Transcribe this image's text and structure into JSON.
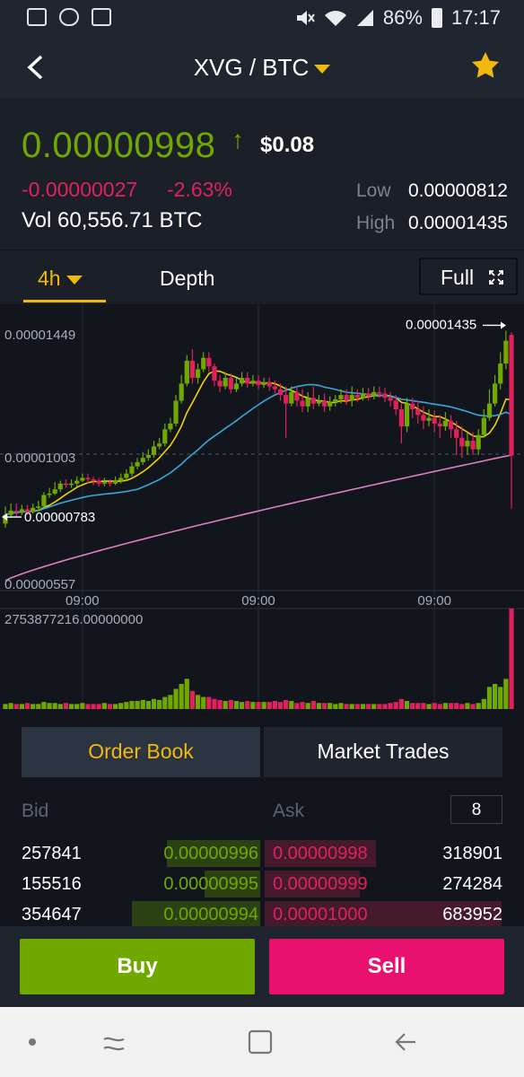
{
  "status_bar": {
    "battery": "86%",
    "time": "17:17",
    "icons": [
      "image-icon",
      "incognito-icon",
      "notification-icon",
      "mute-icon",
      "wifi-icon",
      "signal-icon",
      "battery-icon"
    ]
  },
  "header": {
    "pair": "XVG / BTC",
    "back_icon": "chevron-left-icon",
    "favorite_icon": "star-icon",
    "accent_color": "#f0b90b"
  },
  "ticker": {
    "last_price": "0.00000998",
    "direction_arrow": "↑",
    "usd_price": "$0.08",
    "change_abs": "-0.00000027",
    "change_pct": "-2.63%",
    "volume": "Vol 60,556.71 BTC",
    "low_label": "Low",
    "low_value": "0.00000812",
    "high_label": "High",
    "high_value": "0.00001435",
    "up_color": "#70a800",
    "down_color": "#e0215d"
  },
  "chart_tabs": {
    "interval": "4h",
    "depth": "Depth",
    "full": "Full"
  },
  "chart_data": {
    "type": "candlestick",
    "interval": "4h",
    "y_axis_labels": [
      "0.00001449",
      "0.00001003",
      "0.00000557"
    ],
    "ylim": [
      5.57e-06,
      1.449e-05
    ],
    "x_tick_labels": [
      "09:00",
      "09:00",
      "09:00"
    ],
    "x_tick_indices": [
      14,
      46,
      78
    ],
    "high_marker": "0.00001435",
    "low_marker": "0.00000783",
    "volume_axis_label": "2753877216.00000000",
    "dashed_reference_price": 1.003e-05,
    "candles": [
      [
        7.6e-06,
        7.9e-06,
        8.2e-06,
        7.45e-06
      ],
      [
        7.9e-06,
        8.05e-06,
        8.3e-06,
        7.8e-06
      ],
      [
        8.05e-06,
        8e-06,
        8.3e-06,
        7.83e-06
      ],
      [
        8e-06,
        8.1e-06,
        8.25e-06,
        7.9e-06
      ],
      [
        8.1e-06,
        8e-06,
        8.25e-06,
        7.9e-06
      ],
      [
        8e-06,
        8.15e-06,
        8.3e-06,
        7.95e-06
      ],
      [
        8.15e-06,
        8.2e-06,
        8.4e-06,
        8.05e-06
      ],
      [
        8.2e-06,
        8.6e-06,
        8.7e-06,
        8.15e-06
      ],
      [
        8.6e-06,
        8.65e-06,
        8.85e-06,
        8.5e-06
      ],
      [
        8.65e-06,
        8.8e-06,
        9.05e-06,
        8.6e-06
      ],
      [
        8.8e-06,
        9e-06,
        9.1e-06,
        8.7e-06
      ],
      [
        9e-06,
        8.95e-06,
        9.15e-06,
        8.85e-06
      ],
      [
        8.95e-06,
        9e-06,
        9.15e-06,
        8.85e-06
      ],
      [
        9e-06,
        9.1e-06,
        9.25e-06,
        8.9e-06
      ],
      [
        9.1e-06,
        9.2e-06,
        9.35e-06,
        9.05e-06
      ],
      [
        9.2e-06,
        9.15e-06,
        9.35e-06,
        9e-06
      ],
      [
        9.15e-06,
        9.1e-06,
        9.25e-06,
        8.95e-06
      ],
      [
        9.1e-06,
        9e-06,
        9.2e-06,
        8.9e-06
      ],
      [
        9e-06,
        9.05e-06,
        9.2e-06,
        8.9e-06
      ],
      [
        9.05e-06,
        9e-06,
        9.15e-06,
        8.9e-06
      ],
      [
        9e-06,
        9.1e-06,
        9.25e-06,
        8.95e-06
      ],
      [
        9.1e-06,
        9.2e-06,
        9.35e-06,
        9e-06
      ],
      [
        9.2e-06,
        9.35e-06,
        9.5e-06,
        9.1e-06
      ],
      [
        9.35e-06,
        9.6e-06,
        9.75e-06,
        9.25e-06
      ],
      [
        9.6e-06,
        9.75e-06,
        9.9e-06,
        9.5e-06
      ],
      [
        9.75e-06,
        9.9e-06,
        1.01e-05,
        9.65e-06
      ],
      [
        9.9e-06,
        1e-05,
        1.02e-05,
        9.8e-06
      ],
      [
        1e-05,
        1.03e-05,
        1.05e-05,
        9.9e-06
      ],
      [
        1.03e-05,
        1.04e-05,
        1.06e-05,
        1.02e-05
      ],
      [
        1.04e-05,
        1.09e-05,
        1.11e-05,
        1.03e-05
      ],
      [
        1.09e-05,
        1.11e-05,
        1.13e-05,
        1.08e-05
      ],
      [
        1.11e-05,
        1.19e-05,
        1.21e-05,
        1.1e-05
      ],
      [
        1.19e-05,
        1.25e-05,
        1.28e-05,
        1.18e-05
      ],
      [
        1.25e-05,
        1.33e-05,
        1.35e-05,
        1.24e-05
      ],
      [
        1.33e-05,
        1.27e-05,
        1.37e-05,
        1.25e-05
      ],
      [
        1.27e-05,
        1.3e-05,
        1.32e-05,
        1.25e-05
      ],
      [
        1.3e-05,
        1.34e-05,
        1.36e-05,
        1.29e-05
      ],
      [
        1.34e-05,
        1.31e-05,
        1.36e-05,
        1.29e-05
      ],
      [
        1.31e-05,
        1.26e-05,
        1.32e-05,
        1.24e-05
      ],
      [
        1.26e-05,
        1.24e-05,
        1.28e-05,
        1.22e-05
      ],
      [
        1.24e-05,
        1.27e-05,
        1.29e-05,
        1.23e-05
      ],
      [
        1.27e-05,
        1.23e-05,
        1.285e-05,
        1.215e-05
      ],
      [
        1.23e-05,
        1.25e-05,
        1.27e-05,
        1.22e-05
      ],
      [
        1.25e-05,
        1.27e-05,
        1.29e-05,
        1.24e-05
      ],
      [
        1.27e-05,
        1.25e-05,
        1.29e-05,
        1.235e-05
      ],
      [
        1.25e-05,
        1.26e-05,
        1.28e-05,
        1.24e-05
      ],
      [
        1.26e-05,
        1.245e-05,
        1.28e-05,
        1.23e-05
      ],
      [
        1.245e-05,
        1.255e-05,
        1.27e-05,
        1.235e-05
      ],
      [
        1.255e-05,
        1.24e-05,
        1.27e-05,
        1.225e-05
      ],
      [
        1.24e-05,
        1.23e-05,
        1.26e-05,
        1.215e-05
      ],
      [
        1.23e-05,
        1.21e-05,
        1.25e-05,
        1.19e-05
      ],
      [
        1.21e-05,
        1.18e-05,
        1.24e-05,
        1.06e-05
      ],
      [
        1.18e-05,
        1.22e-05,
        1.24e-05,
        1.17e-05
      ],
      [
        1.22e-05,
        1.19e-05,
        1.24e-05,
        1.17e-05
      ],
      [
        1.19e-05,
        1.17e-05,
        1.23e-05,
        1.15e-05
      ],
      [
        1.17e-05,
        1.2e-05,
        1.22e-05,
        1.15e-05
      ],
      [
        1.2e-05,
        1.18e-05,
        1.24e-05,
        1.16e-05
      ],
      [
        1.18e-05,
        1.19e-05,
        1.21e-05,
        1.17e-05
      ],
      [
        1.19e-05,
        1.17e-05,
        1.215e-05,
        1.15e-05
      ],
      [
        1.17e-05,
        1.185e-05,
        1.205e-05,
        1.155e-05
      ],
      [
        1.185e-05,
        1.195e-05,
        1.21e-05,
        1.17e-05
      ],
      [
        1.195e-05,
        1.21e-05,
        1.23e-05,
        1.18e-05
      ],
      [
        1.21e-05,
        1.19e-05,
        1.23e-05,
        1.175e-05
      ],
      [
        1.19e-05,
        1.21e-05,
        1.24e-05,
        1.17e-05
      ],
      [
        1.21e-05,
        1.2e-05,
        1.23e-05,
        1.185e-05
      ],
      [
        1.2e-05,
        1.215e-05,
        1.235e-05,
        1.19e-05
      ],
      [
        1.215e-05,
        1.205e-05,
        1.235e-05,
        1.19e-05
      ],
      [
        1.205e-05,
        1.22e-05,
        1.24e-05,
        1.195e-05
      ],
      [
        1.22e-05,
        1.215e-05,
        1.24e-05,
        1.2e-05
      ],
      [
        1.215e-05,
        1.2e-05,
        1.235e-05,
        1.185e-05
      ],
      [
        1.2e-05,
        1.19e-05,
        1.22e-05,
        1.17e-05
      ],
      [
        1.19e-05,
        1.16e-05,
        1.21e-05,
        1.14e-05
      ],
      [
        1.16e-05,
        1.1e-05,
        1.18e-05,
        1.04e-05
      ],
      [
        1.1e-05,
        1.18e-05,
        1.2e-05,
        1.08e-05
      ],
      [
        1.18e-05,
        1.16e-05,
        1.2e-05,
        1.13e-05
      ],
      [
        1.16e-05,
        1.14e-05,
        1.19e-05,
        1.11e-05
      ],
      [
        1.14e-05,
        1.12e-05,
        1.17e-05,
        1.09e-05
      ],
      [
        1.12e-05,
        1.13e-05,
        1.16e-05,
        1.1e-05
      ],
      [
        1.13e-05,
        1.11e-05,
        1.155e-05,
        1.08e-05
      ],
      [
        1.11e-05,
        1.1e-05,
        1.14e-05,
        1.06e-05
      ],
      [
        1.1e-05,
        1.12e-05,
        1.15e-05,
        1.085e-05
      ],
      [
        1.12e-05,
        1.09e-05,
        1.14e-05,
        1.06e-05
      ],
      [
        1.09e-05,
        1.06e-05,
        1.12e-05,
        1e-05
      ],
      [
        1.06e-05,
        1.03e-05,
        1.1e-05,
        9.9e-06
      ],
      [
        1.03e-05,
        1.05e-05,
        1.08e-05,
        1e-05
      ],
      [
        1.05e-05,
        1.02e-05,
        1.08e-05,
        1e-05
      ],
      [
        1.02e-05,
        1.07e-05,
        1.09e-05,
        1e-05
      ],
      [
        1.07e-05,
        1.13e-05,
        1.16e-05,
        1.06e-05
      ],
      [
        1.13e-05,
        1.18e-05,
        1.23e-05,
        1.12e-05
      ],
      [
        1.18e-05,
        1.25e-05,
        1.28e-05,
        1.17e-05
      ],
      [
        1.25e-05,
        1.32e-05,
        1.36e-05,
        1.23e-05
      ],
      [
        1.32e-05,
        1.4e-05,
        1.435e-05,
        1.3e-05
      ],
      [
        1.42e-05,
        9.98e-06,
        1.43e-05,
        8.12e-06
      ]
    ],
    "volumes": [
      0.05,
      0.06,
      0.05,
      0.05,
      0.06,
      0.05,
      0.05,
      0.07,
      0.06,
      0.06,
      0.05,
      0.06,
      0.05,
      0.05,
      0.06,
      0.05,
      0.05,
      0.05,
      0.06,
      0.05,
      0.05,
      0.06,
      0.07,
      0.08,
      0.08,
      0.09,
      0.08,
      0.1,
      0.09,
      0.12,
      0.14,
      0.2,
      0.25,
      0.3,
      0.18,
      0.14,
      0.12,
      0.12,
      0.1,
      0.09,
      0.08,
      0.09,
      0.08,
      0.07,
      0.08,
      0.07,
      0.07,
      0.07,
      0.07,
      0.08,
      0.07,
      0.09,
      0.08,
      0.06,
      0.07,
      0.06,
      0.08,
      0.06,
      0.06,
      0.06,
      0.05,
      0.06,
      0.05,
      0.05,
      0.05,
      0.05,
      0.05,
      0.05,
      0.05,
      0.05,
      0.06,
      0.07,
      0.1,
      0.08,
      0.06,
      0.06,
      0.06,
      0.05,
      0.06,
      0.05,
      0.06,
      0.06,
      0.06,
      0.05,
      0.06,
      0.05,
      0.06,
      0.1,
      0.22,
      0.25,
      0.22,
      0.3,
      1.0
    ],
    "series": [
      {
        "color": "#f0d300"
      },
      {
        "color": "#3ba7d6"
      },
      {
        "color": "#e07fc4"
      }
    ],
    "colors": {
      "up": "#70a800",
      "down": "#e0215d"
    }
  },
  "order_book": {
    "tab_book": "Order Book",
    "tab_trades": "Market Trades",
    "bid_label": "Bid",
    "ask_label": "Ask",
    "depth_value": "8",
    "rows": [
      {
        "bid_qty": "257841",
        "bid_price": "0.00000996",
        "ask_price": "0.00000998",
        "ask_qty": "318901",
        "bid_depth": 0.4,
        "ask_depth": 0.47
      },
      {
        "bid_qty": "155516",
        "bid_price": "0.00000995",
        "ask_price": "0.00000999",
        "ask_qty": "274284",
        "bid_depth": 0.24,
        "ask_depth": 0.4
      },
      {
        "bid_qty": "354647",
        "bid_price": "0.00000994",
        "ask_price": "0.00001000",
        "ask_qty": "683952",
        "bid_depth": 0.55,
        "ask_depth": 1.0
      }
    ]
  },
  "actions": {
    "buy": "Buy",
    "sell": "Sell",
    "buy_color": "#70a800",
    "sell_color": "#e8116f"
  },
  "nav": {
    "icons": [
      "dot-icon",
      "recents-icon",
      "home-icon",
      "back-icon"
    ]
  }
}
